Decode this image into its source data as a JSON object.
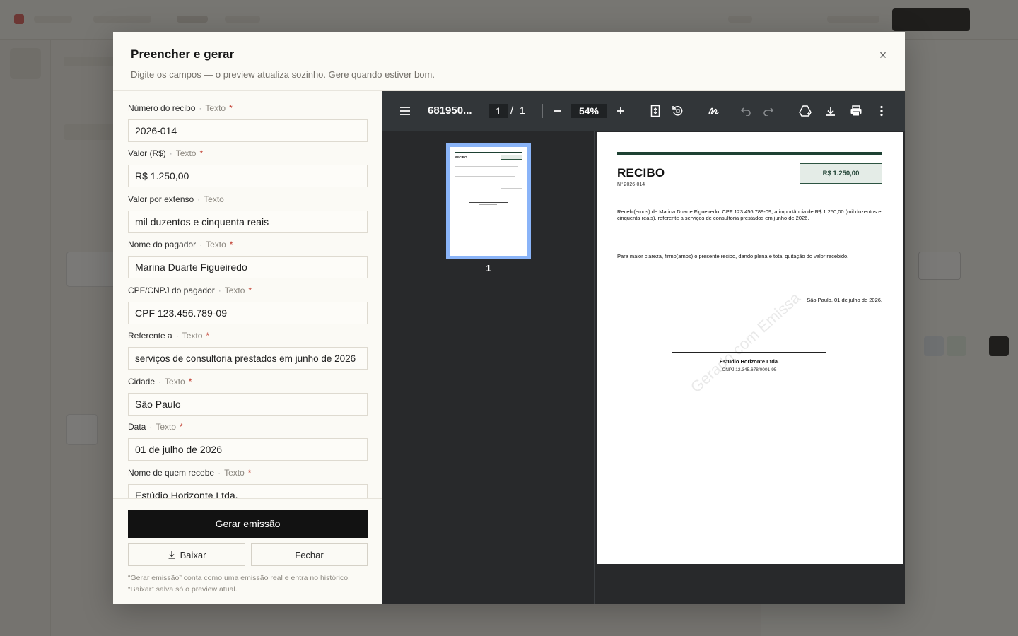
{
  "modal": {
    "title": "Preencher e gerar",
    "subtitle": "Digite os campos — o preview atualiza sozinho. Gere quando estiver bom.",
    "close_label": "×"
  },
  "form": {
    "type_label": "Texto",
    "required_mark": "*",
    "fields": [
      {
        "label": "Número do recibo",
        "value": "2026-014",
        "required": true
      },
      {
        "label": "Valor (R$)",
        "value": "R$ 1.250,00",
        "required": true
      },
      {
        "label": "Valor por extenso",
        "value": "mil duzentos e cinquenta reais",
        "required": false
      },
      {
        "label": "Nome do pagador",
        "value": "Marina Duarte Figueiredo",
        "required": true
      },
      {
        "label": "CPF/CNPJ do pagador",
        "value": "CPF 123.456.789-09",
        "required": true
      },
      {
        "label": "Referente a",
        "value": "serviços de consultoria prestados em junho de 2026",
        "required": true
      },
      {
        "label": "Cidade",
        "value": "São Paulo",
        "required": true
      },
      {
        "label": "Data",
        "value": "01 de julho de 2026",
        "required": true
      },
      {
        "label": "Nome de quem recebe",
        "value": "Estúdio Horizonte Ltda.",
        "required": true
      }
    ],
    "generate_label": "Gerar emissão",
    "download_label": "Baixar",
    "close_label": "Fechar",
    "note_line1": "“Gerar emissão” conta como uma emissão real e entra no histórico.",
    "note_line2": "“Baixar” salva só o preview atual."
  },
  "viewer": {
    "file_title": "681950...",
    "current_page": "1",
    "page_sep": "/",
    "total_pages": "1",
    "zoom": "54%",
    "thumb_label": "1"
  },
  "receipt": {
    "title": "RECIBO",
    "number": "Nº 2026-014",
    "value": "R$ 1.250,00",
    "body": "Recebi(emos) de Marina Duarte Figueiredo, CPF 123.456.789-09, a importância de R$ 1.250,00 (mil duzentos e cinquenta reais), referente a serviços de consultoria prestados em junho de 2026.",
    "clarity": "Para maior clareza, firmo(amos) o presente recibo, dando plena e total quitação do valor recebido.",
    "place_date": "São Paulo, 01 de julho de 2026.",
    "signer_name": "Estúdio Horizonte Ltda.",
    "signer_doc": "CNPJ 12.345.678/0001-95",
    "watermark": "Gerado com Emissa",
    "accent_color": "#1e4133"
  }
}
